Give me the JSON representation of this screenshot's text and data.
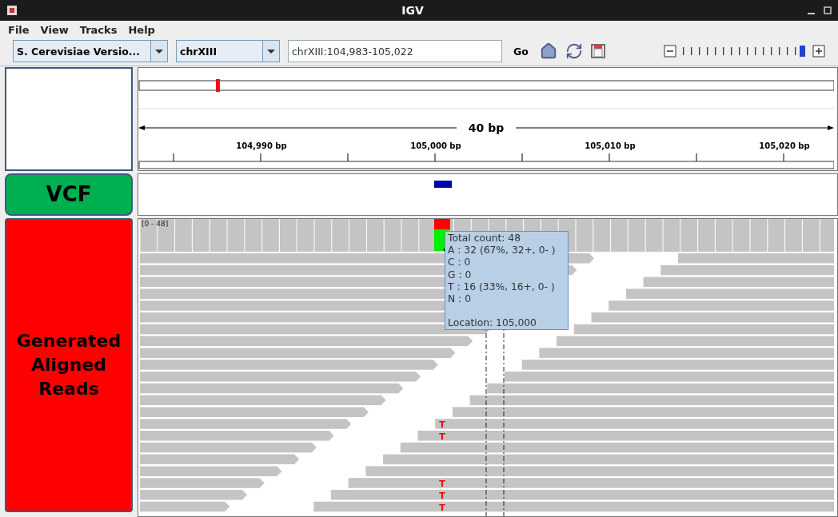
{
  "window": {
    "title": "IGV"
  },
  "menu": [
    {
      "label": "File"
    },
    {
      "label": "View"
    },
    {
      "label": "Tracks"
    },
    {
      "label": "Help"
    }
  ],
  "toolbar": {
    "genome": "S. Cerevisiae Versio...",
    "chromosome": "chrXIII",
    "locus": "chrXIII:104,983-105,022",
    "go": "Go",
    "zoom": {
      "level": 0.96
    }
  },
  "ruler": {
    "span": "40 bp",
    "ticks": [
      "104,990 bp",
      "105,000 bp",
      "105,010 bp",
      "105,020 bp"
    ]
  },
  "tracks": [
    {
      "name": "VCF",
      "kind": "variant",
      "color": "#00b050"
    },
    {
      "name": "Generated Aligned Reads",
      "kind": "alignment",
      "color": "#ff0000"
    }
  ],
  "coverage": {
    "range": "[0 - 48]"
  },
  "tooltip": {
    "counts": [
      "Total count: 48",
      "A : 32 (67%, 32+, 0- )",
      "C : 0",
      "G : 0",
      "T : 16 (33%, 16+, 0- )",
      "N : 0"
    ],
    "location": "Location: 105,000"
  },
  "reads": [
    {
      "kind": "plain"
    },
    {
      "kind": "plain"
    },
    {
      "kind": "plain"
    },
    {
      "kind": "plain"
    },
    {
      "kind": "plain"
    },
    {
      "kind": "plain"
    },
    {
      "kind": "plain"
    },
    {
      "kind": "plain"
    },
    {
      "kind": "plain"
    },
    {
      "kind": "plain"
    },
    {
      "kind": "plain"
    },
    {
      "kind": "plain"
    },
    {
      "kind": "plain"
    },
    {
      "kind": "plain"
    },
    {
      "kind": "mismatch",
      "base": "T"
    },
    {
      "kind": "mismatch",
      "base": "T"
    },
    {
      "kind": "plain"
    },
    {
      "kind": "plain"
    },
    {
      "kind": "plain"
    },
    {
      "kind": "mismatch",
      "base": "T"
    },
    {
      "kind": "mismatch",
      "base": "T"
    },
    {
      "kind": "mismatch",
      "base": "T"
    }
  ]
}
